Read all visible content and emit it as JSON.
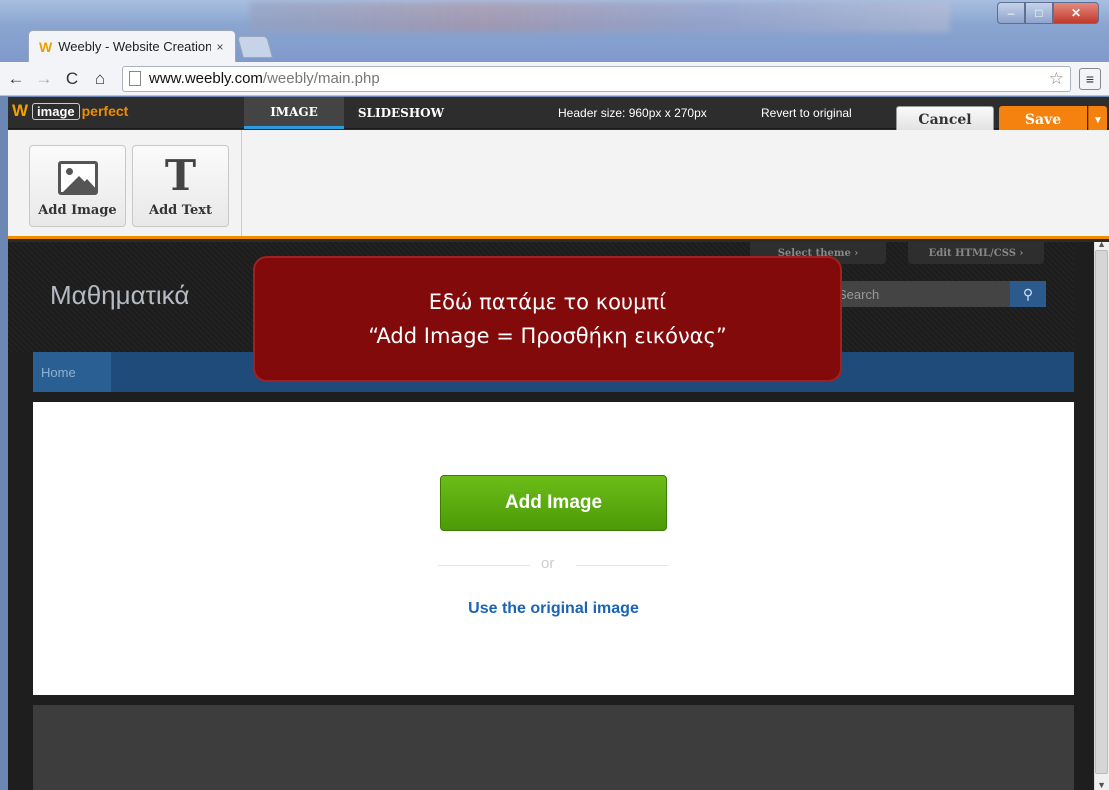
{
  "browser": {
    "tab_title": "Weebly - Website Creation",
    "tab_close": "×",
    "url_host": "www.weebly.com",
    "url_path": "/weebly/main.php"
  },
  "app": {
    "logo_image": "image",
    "logo_perfect": "perfect",
    "tabs": [
      {
        "label": "IMAGE",
        "active": true
      },
      {
        "label": "SLIDESHOW",
        "active": false
      }
    ],
    "header_size": "Header size: 960px x 270px",
    "revert_label": "Revert to original",
    "cancel_label": "Cancel",
    "save_label": "Save",
    "tools": [
      {
        "label": "Add Image",
        "icon": "image-icon"
      },
      {
        "label": "Add Text",
        "icon": "text-icon"
      }
    ]
  },
  "site": {
    "theme_tab_1": "Select theme ›",
    "theme_tab_2": "Edit HTML/CSS ›",
    "title": "Μαθηματικά",
    "search_placeholder": "Search",
    "nav_home": "Home",
    "add_image_label": "Add Image",
    "or_label": "or",
    "original_link": "Use the original image"
  },
  "callout": {
    "line1": "Εδώ πατάμε το κουμπί",
    "line2": "“Add Image  = Προσθήκη εικόνας”"
  },
  "colors": {
    "accent_orange": "#f08c00",
    "add_button_green": "#5aaa0e",
    "callout_red": "#820a0a",
    "link_blue": "#1a64b5"
  }
}
